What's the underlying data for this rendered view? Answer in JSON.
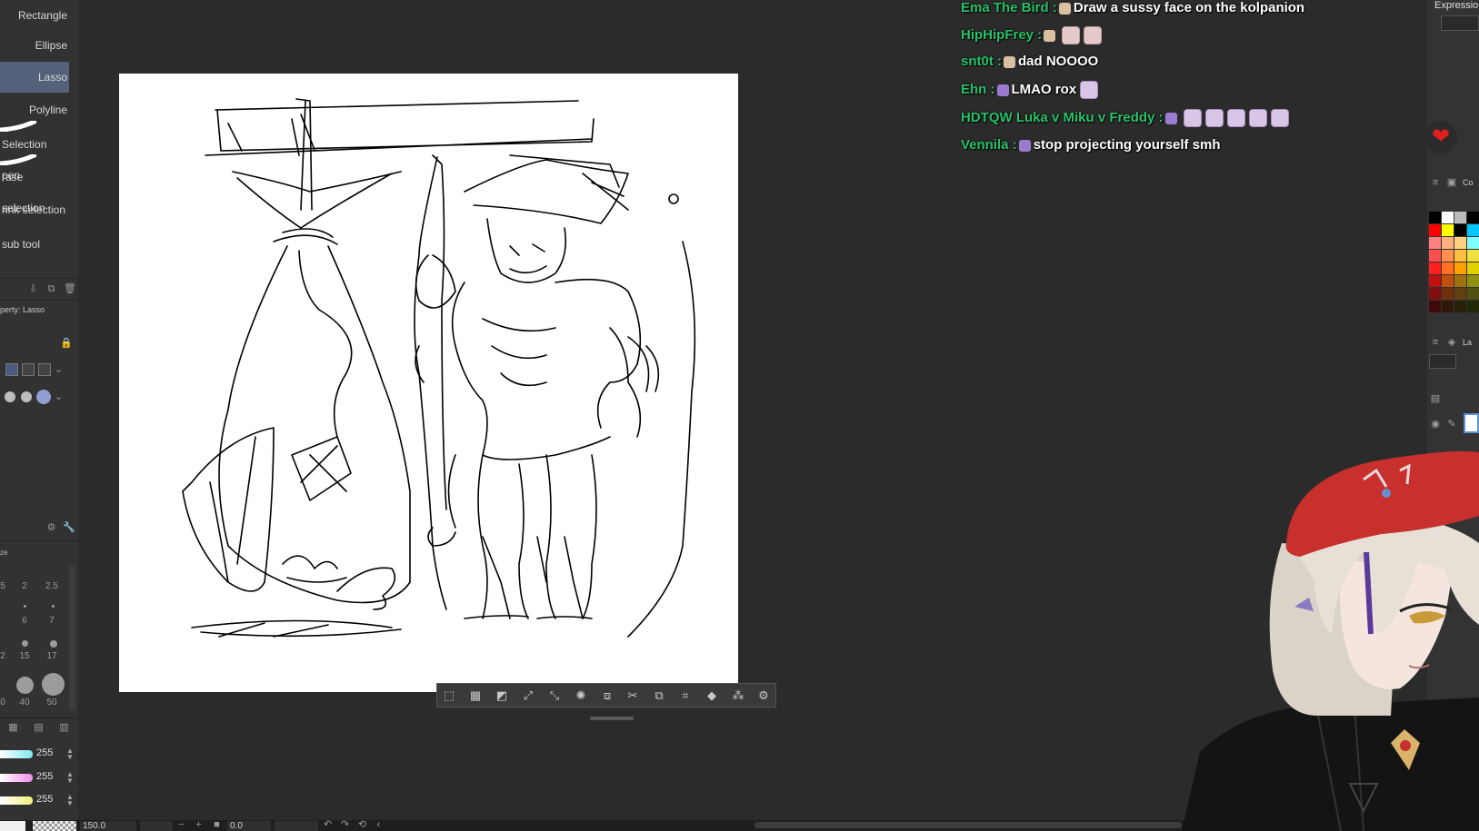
{
  "left_panel": {
    "subtools": [
      {
        "label": "Rectangle",
        "selected": false
      },
      {
        "label": "Ellipse",
        "selected": false
      },
      {
        "label": "Lasso",
        "selected": true
      },
      {
        "label": "Polyline",
        "selected": false
      },
      {
        "label": "Selection pen",
        "selected": false
      },
      {
        "label": "rase selection",
        "selected": false
      },
      {
        "label": "rink selection",
        "selected": false
      },
      {
        "label": "sub tool",
        "selected": false
      }
    ],
    "property_label": "perty: Lasso",
    "size_label": "ze",
    "brush_sizes": [
      "5",
      "2",
      "2.5",
      "6",
      "7",
      "2",
      "15",
      "17",
      "0",
      "40",
      "50"
    ],
    "color_sliders": [
      {
        "value": "255",
        "color": "#7fe8f0"
      },
      {
        "value": "255",
        "color": "#f08ce8"
      },
      {
        "value": "255",
        "color": "#f0f080"
      }
    ]
  },
  "status_bar": {
    "zoom": "150.0",
    "angle": "0.0"
  },
  "chat": [
    {
      "user": "Ema The Bird :",
      "message": "Draw a sussy face on the kolpanion",
      "emotes": 0
    },
    {
      "user": "HipHipFrey :",
      "message": "",
      "emotes": 2
    },
    {
      "user": "snt0t :",
      "message": "dad NOOOO",
      "emotes": 0
    },
    {
      "user": "Ehn :",
      "message": "LMAO rox",
      "emotes": 1
    },
    {
      "user": "HDTQW Luka v Miku v Freddy :",
      "message": "",
      "emotes": 5
    },
    {
      "user": "Vennila :",
      "message": "stop projecting yourself smh",
      "emotes": 0
    }
  ],
  "right_panel": {
    "expression_label": "Expressio",
    "color_tab_label": "Co",
    "layer_tab_label": "La",
    "heart_icon": "heart-icon"
  },
  "colors": {
    "accent_selected": "#55607a",
    "chat_username": "#27c26a",
    "canvas": "#ffffff"
  }
}
